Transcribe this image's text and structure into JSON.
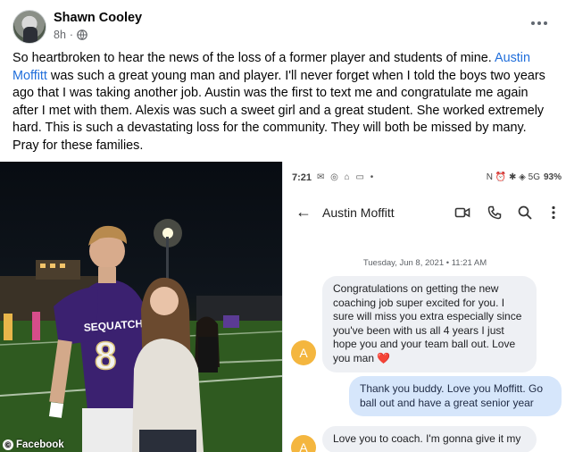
{
  "post": {
    "author": "Shawn Cooley",
    "time": "8h",
    "time_separator": "·",
    "privacy_icon": "globe-icon",
    "more_icon": "more-options-icon",
    "body_before_mention": "So heartbroken to hear the news of the loss of a former player and students of mine. ",
    "mention": "Austin Moffitt",
    "body_after_mention": " was such a great young man and player. I'll never forget when I told the boys two years ago that I was taking another job. Austin was the first to text me and congratulate me again after I met with them. Alexis was such a sweet girl and a great student. She worked extremely hard. This is such a devastating loss for the community. They will both be missed by many. Pray for these families."
  },
  "photo": {
    "jersey_text": "SEQUATCHIE",
    "jersey_number": "8",
    "credit": "Facebook",
    "jersey_color": "#3b2170",
    "field_color": "#315a22"
  },
  "phone": {
    "status_time": "7:21",
    "status_left_icons": "✉ ◎ ⌂ ▭ •",
    "status_right": "N ⏰ ✱ ◈ 5G",
    "battery": "93%",
    "faded_text": "",
    "contact_name": "Austin Moffitt",
    "header_icons": [
      "video-icon",
      "phone-icon",
      "search-icon",
      "more-vertical-icon"
    ],
    "date_line": "Tuesday, Jun 8, 2021 • 11:21 AM",
    "messages": [
      {
        "direction": "incoming",
        "text": "Congratulations on getting the new coaching job super excited for you. I sure will miss you extra especially since you've been with us all 4 years I just hope you and your team ball out. Love you man ",
        "emoji": "❤️"
      },
      {
        "direction": "outgoing",
        "text": "Thank you buddy. Love you Moffitt. Go ball out and have a great senior year"
      },
      {
        "direction": "incoming",
        "text": "Love you to coach. I'm gonna give it my"
      }
    ],
    "contact_avatar_letter": "A",
    "contact_avatar_color": "#f4b63f"
  }
}
